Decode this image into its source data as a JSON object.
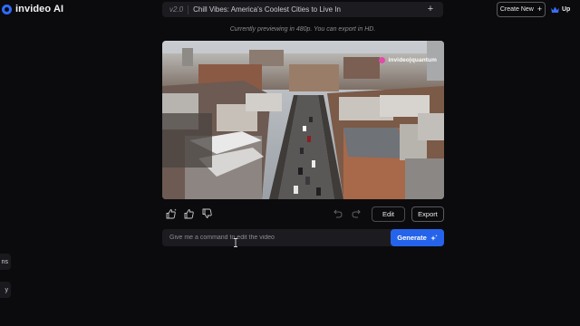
{
  "app": {
    "name": "invideo AI",
    "logo_icon": "invideo-logo-icon"
  },
  "header": {
    "version": "v2.0",
    "video_title": "Chill Vibes: America's Coolest Cities to Live In",
    "add_icon": "plus-icon",
    "create_new_label": "Create New",
    "upgrade_label": "Up",
    "upgrade_icon": "crown-icon"
  },
  "preview": {
    "note": "Currently previewing in 480p. You can export in HD.",
    "watermark": "invideo|quantum",
    "scene": "Aerial drone view of a city street lined with brick apartment buildings in winter"
  },
  "actions": {
    "feedback_icons": [
      "thumbs-up-sparkle-icon",
      "thumbs-up-icon",
      "thumbs-down-icon"
    ],
    "undo_icon": "undo-icon",
    "redo_icon": "redo-icon",
    "edit_label": "Edit",
    "export_label": "Export"
  },
  "command": {
    "placeholder": "Give me a command to edit the video",
    "value": "",
    "generate_label": "Generate",
    "generate_icon": "sparkle-icon"
  },
  "side": {
    "tab_a_label": "ns",
    "tab_b_label": "y"
  },
  "colors": {
    "background": "#0b0b0d",
    "accent": "#2563eb",
    "surface": "#1c1c20",
    "watermark": "#e24aa8"
  }
}
